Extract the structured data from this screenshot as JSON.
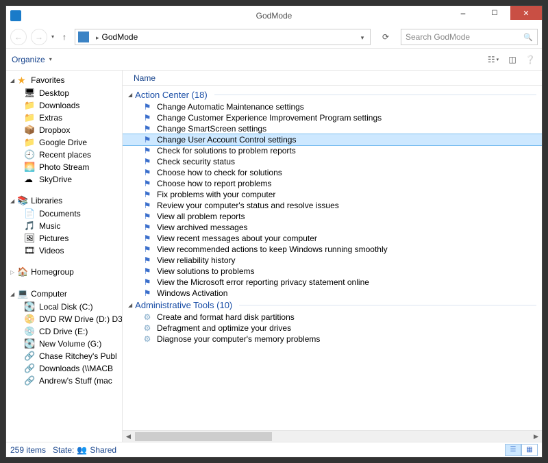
{
  "window": {
    "title": "GodMode"
  },
  "nav": {
    "breadcrumb": "GodMode",
    "search_placeholder": "Search GodMode"
  },
  "toolbar": {
    "organize": "Organize"
  },
  "columns": {
    "name": "Name"
  },
  "sidebar": {
    "favorites": {
      "label": "Favorites",
      "items": [
        {
          "icon": "🖥",
          "label": "Desktop"
        },
        {
          "icon": "📁",
          "label": "Downloads"
        },
        {
          "icon": "📁",
          "label": "Extras"
        },
        {
          "icon": "📦",
          "label": "Dropbox"
        },
        {
          "icon": "📁",
          "label": "Google Drive"
        },
        {
          "icon": "🕘",
          "label": "Recent places"
        },
        {
          "icon": "🌅",
          "label": "Photo Stream"
        },
        {
          "icon": "☁",
          "label": "SkyDrive"
        }
      ]
    },
    "libraries": {
      "label": "Libraries",
      "items": [
        {
          "icon": "📄",
          "label": "Documents"
        },
        {
          "icon": "🎵",
          "label": "Music"
        },
        {
          "icon": "🖼",
          "label": "Pictures"
        },
        {
          "icon": "🎞",
          "label": "Videos"
        }
      ]
    },
    "homegroup": {
      "label": "Homegroup"
    },
    "computer": {
      "label": "Computer",
      "items": [
        {
          "icon": "💽",
          "label": "Local Disk (C:)"
        },
        {
          "icon": "📀",
          "label": "DVD RW Drive (D:) D3"
        },
        {
          "icon": "💿",
          "label": "CD Drive (E:)"
        },
        {
          "icon": "💽",
          "label": "New Volume (G:)"
        },
        {
          "icon": "🔗",
          "label": "Chase Ritchey's Publ"
        },
        {
          "icon": "🔗",
          "label": "Downloads (\\\\MACB"
        },
        {
          "icon": "🔗",
          "label": "Andrew's Stuff (mac"
        }
      ]
    }
  },
  "groups": [
    {
      "title": "Action Center",
      "count": "(18)",
      "icon_type": "flag",
      "items": [
        {
          "label": "Change Automatic Maintenance settings",
          "selected": false
        },
        {
          "label": "Change Customer Experience Improvement Program settings",
          "selected": false
        },
        {
          "label": "Change SmartScreen settings",
          "selected": false
        },
        {
          "label": "Change User Account Control settings",
          "selected": true
        },
        {
          "label": "Check for solutions to problem reports",
          "selected": false
        },
        {
          "label": "Check security status",
          "selected": false
        },
        {
          "label": "Choose how to check for solutions",
          "selected": false
        },
        {
          "label": "Choose how to report problems",
          "selected": false
        },
        {
          "label": "Fix problems with your computer",
          "selected": false
        },
        {
          "label": "Review your computer's status and resolve issues",
          "selected": false
        },
        {
          "label": "View all problem reports",
          "selected": false
        },
        {
          "label": "View archived messages",
          "selected": false
        },
        {
          "label": "View recent messages about your computer",
          "selected": false
        },
        {
          "label": "View recommended actions to keep Windows running smoothly",
          "selected": false
        },
        {
          "label": "View reliability history",
          "selected": false
        },
        {
          "label": "View solutions to problems",
          "selected": false
        },
        {
          "label": "View the Microsoft error reporting privacy statement online",
          "selected": false
        },
        {
          "label": "Windows Activation",
          "selected": false
        }
      ]
    },
    {
      "title": "Administrative Tools",
      "count": "(10)",
      "icon_type": "tool",
      "items": [
        {
          "label": "Create and format hard disk partitions",
          "selected": false
        },
        {
          "label": "Defragment and optimize your drives",
          "selected": false
        },
        {
          "label": "Diagnose your computer's memory problems",
          "selected": false
        }
      ]
    }
  ],
  "status": {
    "items": "259 items",
    "state_label": "State:",
    "state_value": "Shared"
  }
}
